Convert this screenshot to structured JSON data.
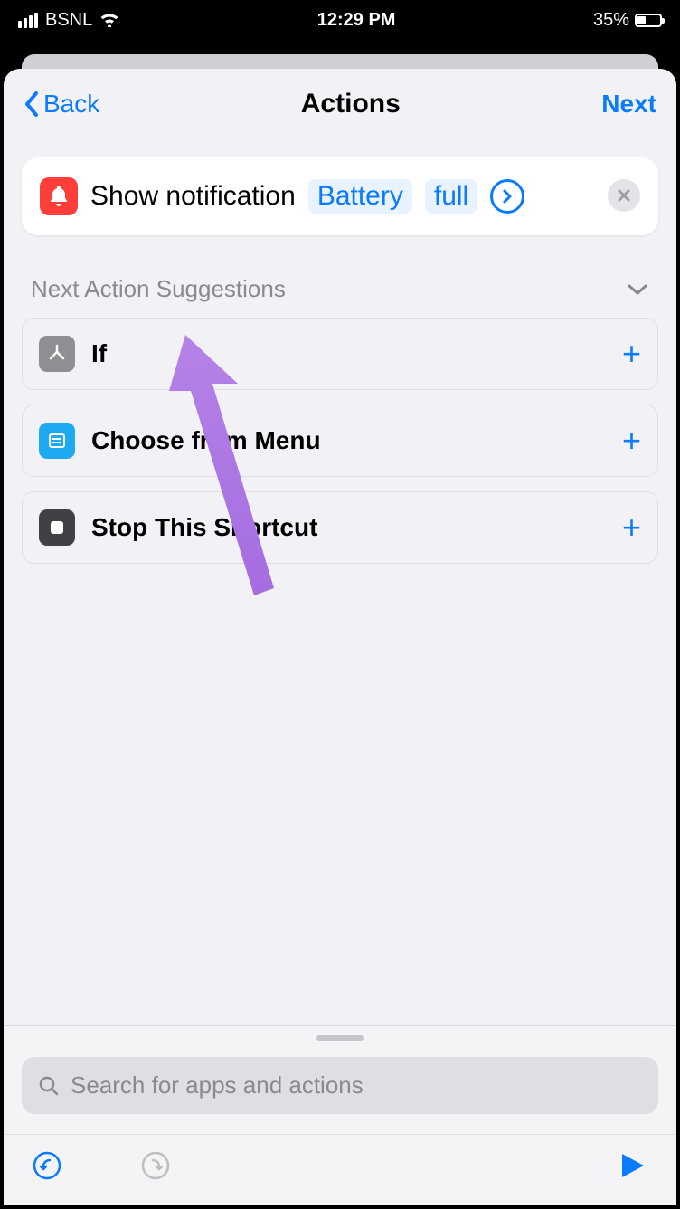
{
  "status": {
    "carrier": "BSNL",
    "time": "12:29 PM",
    "battery_pct": "35%"
  },
  "nav": {
    "back": "Back",
    "title": "Actions",
    "next": "Next"
  },
  "action": {
    "label": "Show notification",
    "token1": "Battery",
    "token2": "full"
  },
  "suggestions": {
    "heading": "Next Action Suggestions",
    "items": [
      {
        "label": "If"
      },
      {
        "label": "Choose from Menu"
      },
      {
        "label": "Stop This Shortcut"
      }
    ]
  },
  "search": {
    "placeholder": "Search for apps and actions"
  }
}
